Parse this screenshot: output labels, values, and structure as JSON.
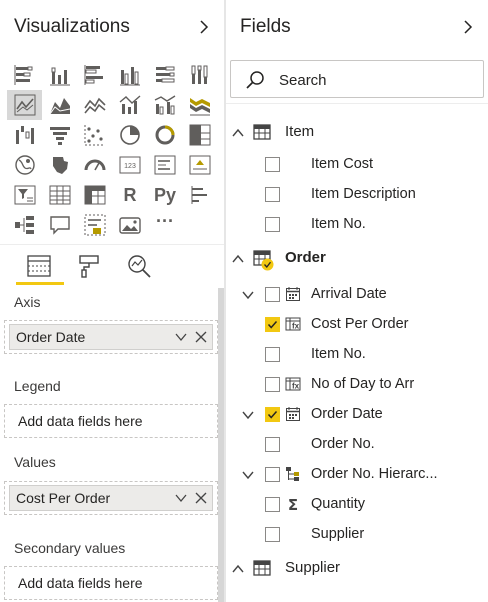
{
  "visualizations": {
    "title": "Visualizations",
    "collapse_icon": "chevron-right-icon",
    "icon_rows": [
      [
        "stacked-bar-chart-icon",
        "stacked-column-chart-icon",
        "clustered-bar-chart-icon",
        "clustered-column-chart-icon",
        "100-stacked-bar-chart-icon",
        "100-stacked-column-chart-icon"
      ],
      [
        "line-chart-icon",
        "area-chart-icon",
        "stacked-area-chart-icon",
        "line-and-stacked-column-chart-icon",
        "line-and-clustered-column-chart-icon",
        "ribbon-chart-icon"
      ],
      [
        "waterfall-chart-icon",
        "funnel-chart-icon",
        "scatter-chart-icon",
        "pie-chart-icon",
        "donut-chart-icon",
        "treemap-icon"
      ],
      [
        "map-icon",
        "filled-map-icon",
        "gauge-icon",
        "card-icon",
        "multi-row-card-icon",
        "kpi-icon"
      ],
      [
        "slicer-icon",
        "table-icon",
        "matrix-icon",
        "r-script-visual-icon",
        "python-visual-icon",
        "key-influencers-icon"
      ],
      [
        "decomposition-tree-icon",
        "qa-icon",
        "smart-narrative-icon",
        "paginated-report-icon",
        "more-visuals-icon"
      ]
    ],
    "icon_glyphs": {
      "r-script-visual-icon": "R",
      "python-visual-icon": "Py",
      "more-visuals-icon": "···"
    },
    "selected_icon": "line-chart-icon",
    "tabs": [
      {
        "name": "fields-tab",
        "icon": "fields-well-icon"
      },
      {
        "name": "format-tab",
        "icon": "paint-roller-icon"
      },
      {
        "name": "analytics-tab",
        "icon": "analytics-magnifier-icon"
      }
    ],
    "wells": {
      "axis": {
        "label": "Axis",
        "field": "Order Date"
      },
      "legend": {
        "label": "Legend",
        "placeholder": "Add data fields here"
      },
      "values": {
        "label": "Values",
        "field": "Cost Per Order"
      },
      "secondary": {
        "label": "Secondary values",
        "placeholder": "Add data fields here"
      }
    }
  },
  "fields": {
    "title": "Fields",
    "collapse_icon": "chevron-right-icon",
    "search": {
      "placeholder": "Search",
      "value": ""
    },
    "tables": {
      "item": {
        "name": "Item",
        "expanded": true,
        "fields": [
          {
            "label": "Item Cost",
            "checked": false,
            "icon": "none"
          },
          {
            "label": "Item Description",
            "checked": false,
            "icon": "none"
          },
          {
            "label": "Item No.",
            "checked": false,
            "icon": "none"
          }
        ]
      },
      "order": {
        "name": "Order",
        "expanded": true,
        "fields": [
          {
            "label": "Arrival Date",
            "checked": false,
            "icon": "calendar-icon",
            "expandable": true
          },
          {
            "label": "Cost Per Order",
            "checked": true,
            "icon": "calculated-column-icon",
            "expandable": false
          },
          {
            "label": "Item No.",
            "checked": false,
            "icon": "none",
            "expandable": false
          },
          {
            "label": "No of Day to Arr",
            "checked": false,
            "icon": "calculated-column-icon",
            "expandable": false
          },
          {
            "label": "Order Date",
            "checked": true,
            "icon": "calendar-icon",
            "expandable": true
          },
          {
            "label": "Order No.",
            "checked": false,
            "icon": "none",
            "expandable": false
          },
          {
            "label": "Order No. Hierarc...",
            "checked": false,
            "icon": "hierarchy-icon",
            "expandable": true
          },
          {
            "label": "Quantity",
            "checked": false,
            "icon": "sigma-icon",
            "expandable": false
          },
          {
            "label": "Supplier",
            "checked": false,
            "icon": "none",
            "expandable": false
          }
        ]
      },
      "supplier": {
        "name": "Supplier",
        "expanded": true,
        "fields": []
      }
    },
    "colors": {
      "accent": "#f2c811",
      "text": "#252423",
      "border": "#c8c6c4"
    }
  }
}
